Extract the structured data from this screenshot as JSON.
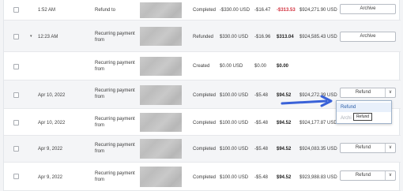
{
  "rows": [
    {
      "date": "1:52 AM",
      "desc": "Refund to",
      "status": "Completed",
      "gross": "-$330.00 USD",
      "fee": "-$16.47",
      "net": "-$313.53",
      "balance": "$924,271.90 USD",
      "action": "Archive",
      "net_color": "#d12f3c"
    },
    {
      "date": "12:23 AM",
      "desc": "Recurring payment from",
      "status": "Refunded",
      "gross": "$330.00 USD",
      "fee": "-$16.96",
      "net": "$313.04",
      "balance": "$924,585.43 USD",
      "action": "Archive",
      "net_color": "#222222"
    },
    {
      "date": "",
      "desc": "Recurring payment from",
      "status": "Created",
      "gross": "$0.00 USD",
      "fee": "$0.00",
      "net": "$0.00",
      "balance": "",
      "action": "",
      "net_color": "#222222"
    },
    {
      "date": "Apr 10, 2022",
      "desc": "Recurring payment from",
      "status": "Completed",
      "gross": "$100.00 USD",
      "fee": "-$5.48",
      "net": "$94.52",
      "balance": "$924,272.39 USD",
      "action": "Refund",
      "net_color": "#222222"
    },
    {
      "date": "Apr 10, 2022",
      "desc": "Recurring payment from",
      "status": "Completed",
      "gross": "$100.00 USD",
      "fee": "-$5.48",
      "net": "$94.52",
      "balance": "$924,177.87 USD",
      "action": "",
      "net_color": "#222222"
    },
    {
      "date": "Apr 9, 2022",
      "desc": "Recurring payment from",
      "status": "Completed",
      "gross": "$100.00 USD",
      "fee": "-$5.48",
      "net": "$94.52",
      "balance": "$924,083.35 USD",
      "action": "Refund",
      "net_color": "#222222"
    },
    {
      "date": "Apr 9, 2022",
      "desc": "Recurring payment from",
      "status": "Completed",
      "gross": "$100.00 USD",
      "fee": "-$5.48",
      "net": "$94.52",
      "balance": "$923,988.83 USD",
      "action": "Refund",
      "net_color": "#222222"
    }
  ],
  "expand_caret": "▾",
  "select_chevron": "∨",
  "dropdown": {
    "options": [
      "Refund",
      "Archi"
    ],
    "tooltip": "Refund"
  },
  "colors": {
    "accent": "#3a62d8",
    "negative": "#d12f3c"
  },
  "icons": {
    "arrow": "blue-arrow-pointer"
  }
}
